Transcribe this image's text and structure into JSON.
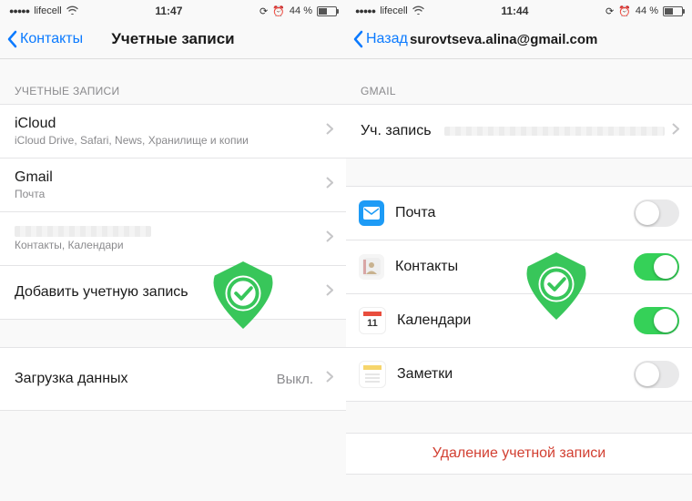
{
  "left": {
    "status": {
      "carrier": "lifecell",
      "time": "11:47",
      "battery": "44 %"
    },
    "nav": {
      "back": "Контакты",
      "title": "Учетные записи"
    },
    "sections": {
      "accounts_header": "УЧЕТНЫЕ ЗАПИСИ",
      "icloud": {
        "title": "iCloud",
        "sub": "iCloud Drive, Safari, News, Хранилище и копии"
      },
      "gmail": {
        "title": "Gmail",
        "sub": "Почта"
      },
      "other": {
        "title": "",
        "sub": "Контакты, Календари"
      },
      "add": "Добавить учетную запись",
      "fetch_label": "Загрузка данных",
      "fetch_value": "Выкл."
    }
  },
  "right": {
    "status": {
      "carrier": "lifecell",
      "time": "11:44",
      "battery": "44 %"
    },
    "nav": {
      "back": "Назад",
      "title": "surovtseva.alina@gmail.com"
    },
    "sections": {
      "gmail_header": "GMAIL",
      "account_label": "Уч. запись",
      "apps": {
        "mail": "Почта",
        "contacts": "Контакты",
        "calendars": "Календари",
        "notes": "Заметки"
      },
      "toggles": {
        "mail": false,
        "contacts": true,
        "calendars": true,
        "notes": false
      },
      "delete": "Удаление учетной записи"
    }
  }
}
